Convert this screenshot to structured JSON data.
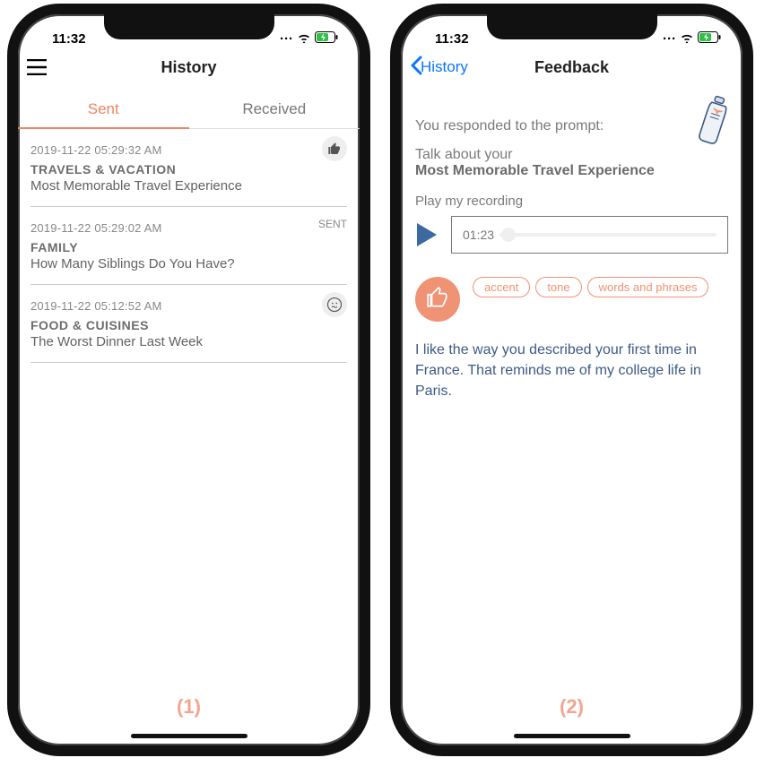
{
  "statusbar": {
    "time": "11:32"
  },
  "history": {
    "nav_title": "History",
    "tab_sent": "Sent",
    "tab_received": "Received",
    "rows": [
      {
        "ts": "2019-11-22 05:29:32 AM",
        "cat": "TRAVELS & VACATION",
        "title": "Most Memorable Travel Experience",
        "badge_type": "thumbs-up"
      },
      {
        "ts": "2019-11-22 05:29:02 AM",
        "cat": "FAMILY",
        "title": "How Many Siblings Do You Have?",
        "badge_type": "text",
        "badge_text": "SENT"
      },
      {
        "ts": "2019-11-22 05:12:52 AM",
        "cat": "FOOD & CUISINES",
        "title": "The Worst Dinner Last Week",
        "badge_type": "face-confused"
      }
    ]
  },
  "feedback": {
    "back_label": "History",
    "nav_title": "Feedback",
    "intro": "You responded to the prompt:",
    "prompt_prefix": "Talk about your",
    "prompt_topic": "Most Memorable Travel Experience",
    "play_label": "Play my recording",
    "track_time": "01:23",
    "chips": {
      "accent": "accent",
      "tone": "tone",
      "words": "words and phrases"
    },
    "comment": "I like the way you described your first time in France. That reminds me of my college life in Paris."
  },
  "figure_labels": {
    "left": "(1)",
    "right": "(2)"
  }
}
